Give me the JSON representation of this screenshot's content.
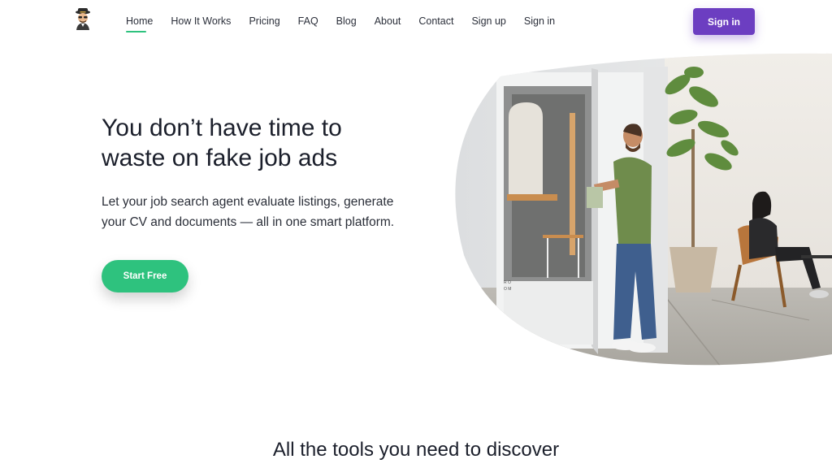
{
  "nav": {
    "links": [
      "Home",
      "How It Works",
      "Pricing",
      "FAQ",
      "Blog",
      "About",
      "Contact",
      "Sign up",
      "Sign in"
    ],
    "active": "Home",
    "signin_button": "Sign in"
  },
  "hero": {
    "title_line1": "You don’t have time to",
    "title_line2": "waste on fake job ads",
    "subtitle_line1": "Let your job search agent evaluate listings, generate",
    "subtitle_line2": "your CV and documents — all in one smart platform.",
    "cta": "Start Free"
  },
  "section": {
    "title": "All the tools you need to discover"
  },
  "colors": {
    "accent_green": "#2ec27e",
    "brand_purple": "#6c3ec1"
  }
}
